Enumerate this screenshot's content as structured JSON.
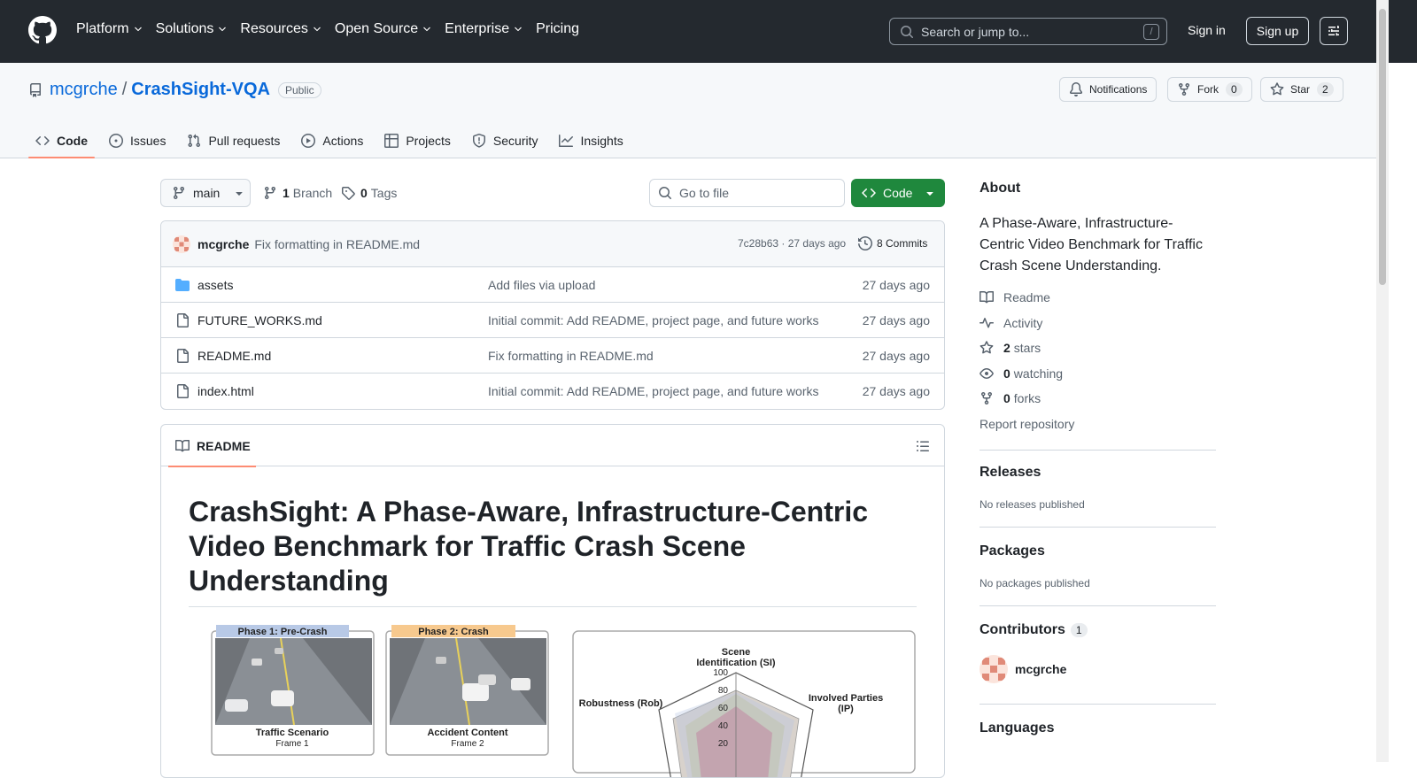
{
  "header": {
    "nav": [
      "Platform",
      "Solutions",
      "Resources",
      "Open Source",
      "Enterprise",
      "Pricing"
    ],
    "search_placeholder": "Search or jump to...",
    "search_shortcut": "/",
    "sign_in": "Sign in",
    "sign_up": "Sign up"
  },
  "repo": {
    "owner": "mcgrche",
    "separator": "/",
    "name": "CrashSight-VQA",
    "visibility": "Public",
    "notifications_label": "Notifications",
    "fork_label": "Fork",
    "fork_count": "0",
    "star_label": "Star",
    "star_count": "2",
    "tabs": [
      "Code",
      "Issues",
      "Pull requests",
      "Actions",
      "Projects",
      "Security",
      "Insights"
    ]
  },
  "toolbar": {
    "branch": "main",
    "branch_count": "1",
    "branch_label": "Branch",
    "tag_count": "0",
    "tag_label": "Tags",
    "go_to_file": "Go to file",
    "code_button": "Code"
  },
  "commit": {
    "user": "mcgrche",
    "message": "Fix formatting in README.md",
    "hash_date": "7c28b63 · 27 days ago",
    "commits_label": "8 Commits"
  },
  "files": [
    {
      "name": "assets",
      "type": "folder",
      "message": "Add files via upload",
      "date": "27 days ago"
    },
    {
      "name": "FUTURE_WORKS.md",
      "type": "file",
      "message": "Initial commit: Add README, project page, and future works",
      "date": "27 days ago"
    },
    {
      "name": "README.md",
      "type": "file",
      "message": "Fix formatting in README.md",
      "date": "27 days ago"
    },
    {
      "name": "index.html",
      "type": "file",
      "message": "Initial commit: Add README, project page, and future works",
      "date": "27 days ago"
    }
  ],
  "readme": {
    "tab": "README",
    "title": "CrashSight: A Phase-Aware, Infrastructure-Centric Video Benchmark for Traffic Crash Scene Understanding",
    "figure": {
      "phase1": "Phase 1: Pre-Crash",
      "phase2": "Phase 2: Crash",
      "caption1": "Traffic Scenario",
      "caption1b": "Frame 1",
      "caption2": "Accident Content",
      "caption2b": "Frame 2",
      "radar_si": "Scene",
      "radar_si2": "Identification (SI)",
      "radar_ip": "Involved Parties",
      "radar_ip2": "(IP)",
      "radar_rob": "Robustness (Rob)",
      "ticks": [
        "100",
        "80",
        "60",
        "40",
        "20"
      ]
    }
  },
  "about": {
    "heading": "About",
    "description": "A Phase-Aware, Infrastructure-Centric Video Benchmark for Traffic Crash Scene Understanding.",
    "readme_link": "Readme",
    "activity_link": "Activity",
    "stars_count": "2",
    "stars_label": "stars",
    "watching_count": "0",
    "watching_label": "watching",
    "forks_count": "0",
    "forks_label": "forks",
    "report": "Report repository"
  },
  "releases": {
    "heading": "Releases",
    "text": "No releases published"
  },
  "packages": {
    "heading": "Packages",
    "text": "No packages published"
  },
  "contributors": {
    "heading": "Contributors",
    "count": "1",
    "user": "mcgrche"
  },
  "languages": {
    "heading": "Languages"
  },
  "colors": {
    "header_bg": "#24292f",
    "link": "#0969da",
    "green": "#1f883d",
    "tab_underline": "#fd8c73"
  }
}
